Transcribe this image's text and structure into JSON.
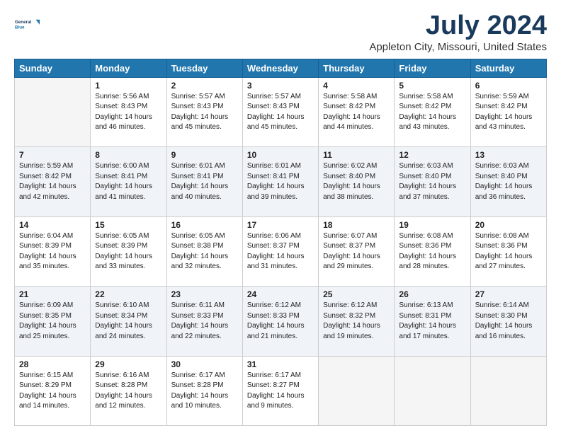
{
  "header": {
    "logo_line1": "General",
    "logo_line2": "Blue",
    "title": "July 2024",
    "subtitle": "Appleton City, Missouri, United States"
  },
  "days_of_week": [
    "Sunday",
    "Monday",
    "Tuesday",
    "Wednesday",
    "Thursday",
    "Friday",
    "Saturday"
  ],
  "weeks": [
    [
      {
        "day": "",
        "empty": true
      },
      {
        "day": "1",
        "sunrise": "5:56 AM",
        "sunset": "8:43 PM",
        "daylight": "14 hours and 46 minutes."
      },
      {
        "day": "2",
        "sunrise": "5:57 AM",
        "sunset": "8:43 PM",
        "daylight": "14 hours and 45 minutes."
      },
      {
        "day": "3",
        "sunrise": "5:57 AM",
        "sunset": "8:43 PM",
        "daylight": "14 hours and 45 minutes."
      },
      {
        "day": "4",
        "sunrise": "5:58 AM",
        "sunset": "8:42 PM",
        "daylight": "14 hours and 44 minutes."
      },
      {
        "day": "5",
        "sunrise": "5:58 AM",
        "sunset": "8:42 PM",
        "daylight": "14 hours and 43 minutes."
      },
      {
        "day": "6",
        "sunrise": "5:59 AM",
        "sunset": "8:42 PM",
        "daylight": "14 hours and 43 minutes."
      }
    ],
    [
      {
        "day": "7",
        "sunrise": "5:59 AM",
        "sunset": "8:42 PM",
        "daylight": "14 hours and 42 minutes."
      },
      {
        "day": "8",
        "sunrise": "6:00 AM",
        "sunset": "8:41 PM",
        "daylight": "14 hours and 41 minutes."
      },
      {
        "day": "9",
        "sunrise": "6:01 AM",
        "sunset": "8:41 PM",
        "daylight": "14 hours and 40 minutes."
      },
      {
        "day": "10",
        "sunrise": "6:01 AM",
        "sunset": "8:41 PM",
        "daylight": "14 hours and 39 minutes."
      },
      {
        "day": "11",
        "sunrise": "6:02 AM",
        "sunset": "8:40 PM",
        "daylight": "14 hours and 38 minutes."
      },
      {
        "day": "12",
        "sunrise": "6:03 AM",
        "sunset": "8:40 PM",
        "daylight": "14 hours and 37 minutes."
      },
      {
        "day": "13",
        "sunrise": "6:03 AM",
        "sunset": "8:40 PM",
        "daylight": "14 hours and 36 minutes."
      }
    ],
    [
      {
        "day": "14",
        "sunrise": "6:04 AM",
        "sunset": "8:39 PM",
        "daylight": "14 hours and 35 minutes."
      },
      {
        "day": "15",
        "sunrise": "6:05 AM",
        "sunset": "8:39 PM",
        "daylight": "14 hours and 33 minutes."
      },
      {
        "day": "16",
        "sunrise": "6:05 AM",
        "sunset": "8:38 PM",
        "daylight": "14 hours and 32 minutes."
      },
      {
        "day": "17",
        "sunrise": "6:06 AM",
        "sunset": "8:37 PM",
        "daylight": "14 hours and 31 minutes."
      },
      {
        "day": "18",
        "sunrise": "6:07 AM",
        "sunset": "8:37 PM",
        "daylight": "14 hours and 29 minutes."
      },
      {
        "day": "19",
        "sunrise": "6:08 AM",
        "sunset": "8:36 PM",
        "daylight": "14 hours and 28 minutes."
      },
      {
        "day": "20",
        "sunrise": "6:08 AM",
        "sunset": "8:36 PM",
        "daylight": "14 hours and 27 minutes."
      }
    ],
    [
      {
        "day": "21",
        "sunrise": "6:09 AM",
        "sunset": "8:35 PM",
        "daylight": "14 hours and 25 minutes."
      },
      {
        "day": "22",
        "sunrise": "6:10 AM",
        "sunset": "8:34 PM",
        "daylight": "14 hours and 24 minutes."
      },
      {
        "day": "23",
        "sunrise": "6:11 AM",
        "sunset": "8:33 PM",
        "daylight": "14 hours and 22 minutes."
      },
      {
        "day": "24",
        "sunrise": "6:12 AM",
        "sunset": "8:33 PM",
        "daylight": "14 hours and 21 minutes."
      },
      {
        "day": "25",
        "sunrise": "6:12 AM",
        "sunset": "8:32 PM",
        "daylight": "14 hours and 19 minutes."
      },
      {
        "day": "26",
        "sunrise": "6:13 AM",
        "sunset": "8:31 PM",
        "daylight": "14 hours and 17 minutes."
      },
      {
        "day": "27",
        "sunrise": "6:14 AM",
        "sunset": "8:30 PM",
        "daylight": "14 hours and 16 minutes."
      }
    ],
    [
      {
        "day": "28",
        "sunrise": "6:15 AM",
        "sunset": "8:29 PM",
        "daylight": "14 hours and 14 minutes."
      },
      {
        "day": "29",
        "sunrise": "6:16 AM",
        "sunset": "8:28 PM",
        "daylight": "14 hours and 12 minutes."
      },
      {
        "day": "30",
        "sunrise": "6:17 AM",
        "sunset": "8:28 PM",
        "daylight": "14 hours and 10 minutes."
      },
      {
        "day": "31",
        "sunrise": "6:17 AM",
        "sunset": "8:27 PM",
        "daylight": "14 hours and 9 minutes."
      },
      {
        "day": "",
        "empty": true
      },
      {
        "day": "",
        "empty": true
      },
      {
        "day": "",
        "empty": true
      }
    ]
  ]
}
